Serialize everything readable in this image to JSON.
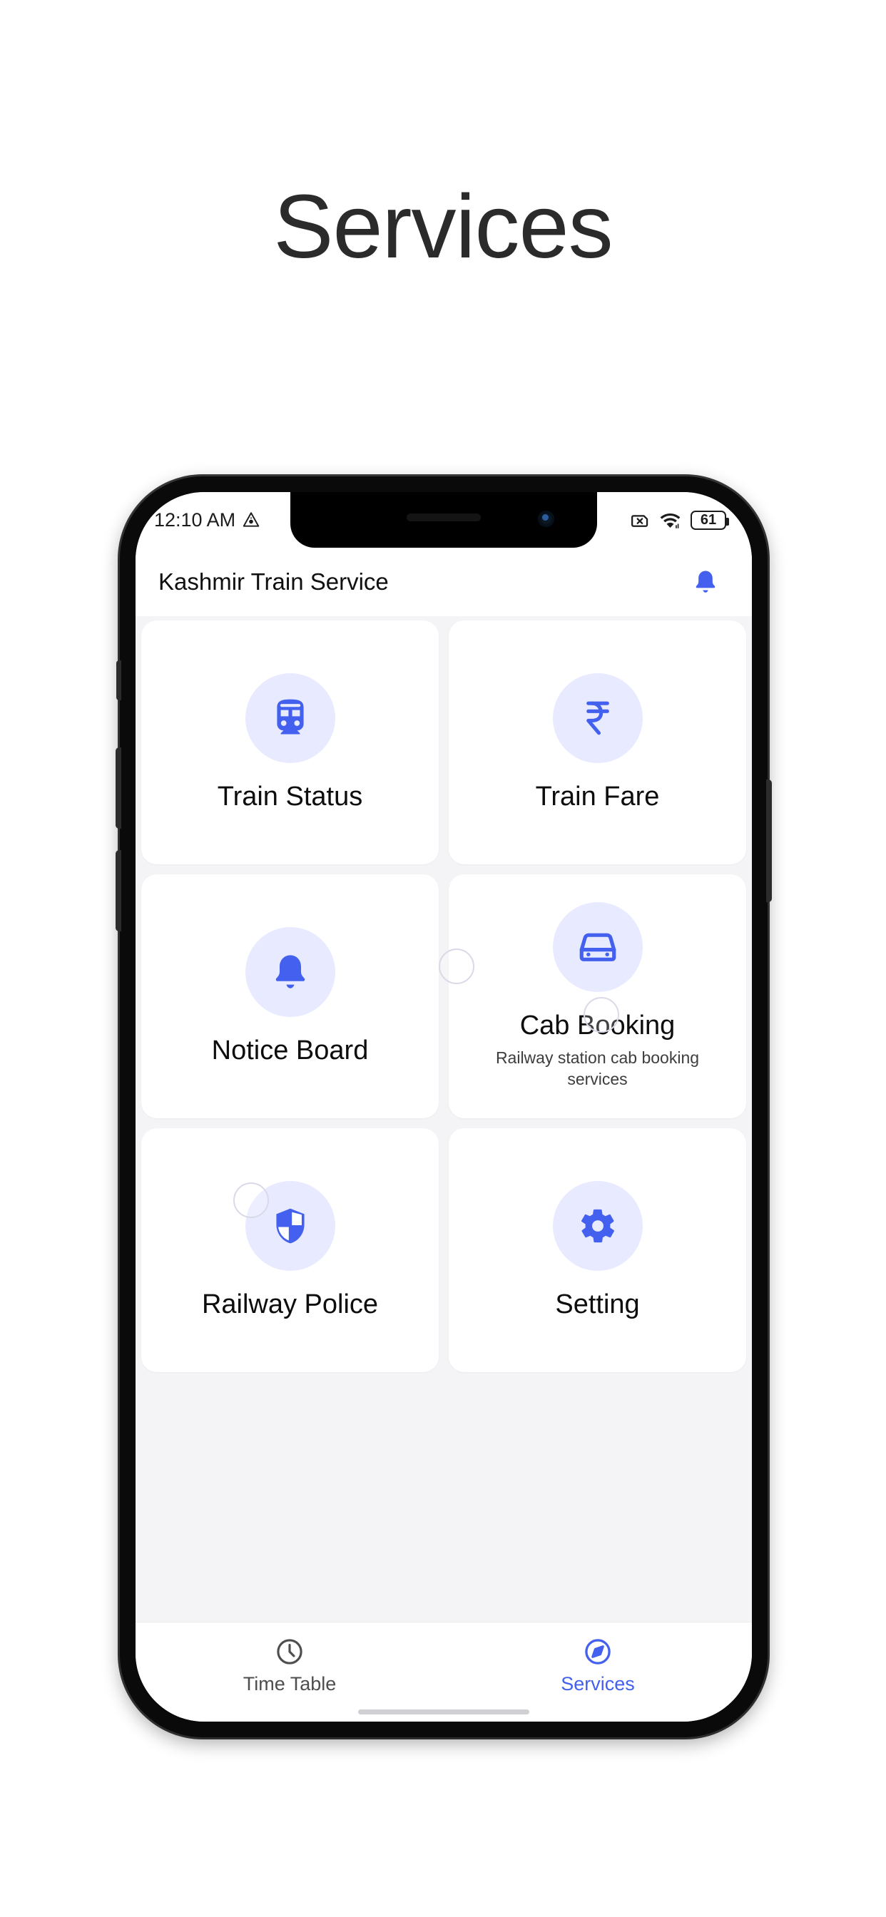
{
  "page": {
    "title": "Services",
    "background": "#ffffff"
  },
  "theme": {
    "accent": "#4361ee",
    "icon_bubble": "#e8eaff",
    "screen_bg": "#f4f4f6",
    "card_bg": "#ffffff",
    "text_primary": "#0d0d0d",
    "text_muted": "#4e4e4e"
  },
  "statusbar": {
    "time": "12:10 AM",
    "alert_icon": "triangle-alert-icon",
    "sim_icon": "no-sim-icon",
    "wifi_icon": "wifi-icon",
    "battery_level": "61",
    "battery_icon": "battery-icon"
  },
  "appbar": {
    "title": "Kashmir Train Service",
    "notification_icon": "bell-icon"
  },
  "services": [
    {
      "label": "Train Status",
      "subtitle": "",
      "icon": "train-icon"
    },
    {
      "label": "Train Fare",
      "subtitle": "",
      "icon": "rupee-icon"
    },
    {
      "label": "Notice Board",
      "subtitle": "",
      "icon": "bell-icon"
    },
    {
      "label": "Cab Booking",
      "subtitle": "Railway station cab booking services",
      "icon": "car-icon"
    },
    {
      "label": "Railway Police",
      "subtitle": "",
      "icon": "shield-icon"
    },
    {
      "label": "Setting",
      "subtitle": "",
      "icon": "gear-icon"
    }
  ],
  "bottom_nav": {
    "items": [
      {
        "label": "Time Table",
        "icon": "clock-icon",
        "active": false
      },
      {
        "label": "Services",
        "icon": "compass-icon",
        "active": true
      }
    ]
  }
}
